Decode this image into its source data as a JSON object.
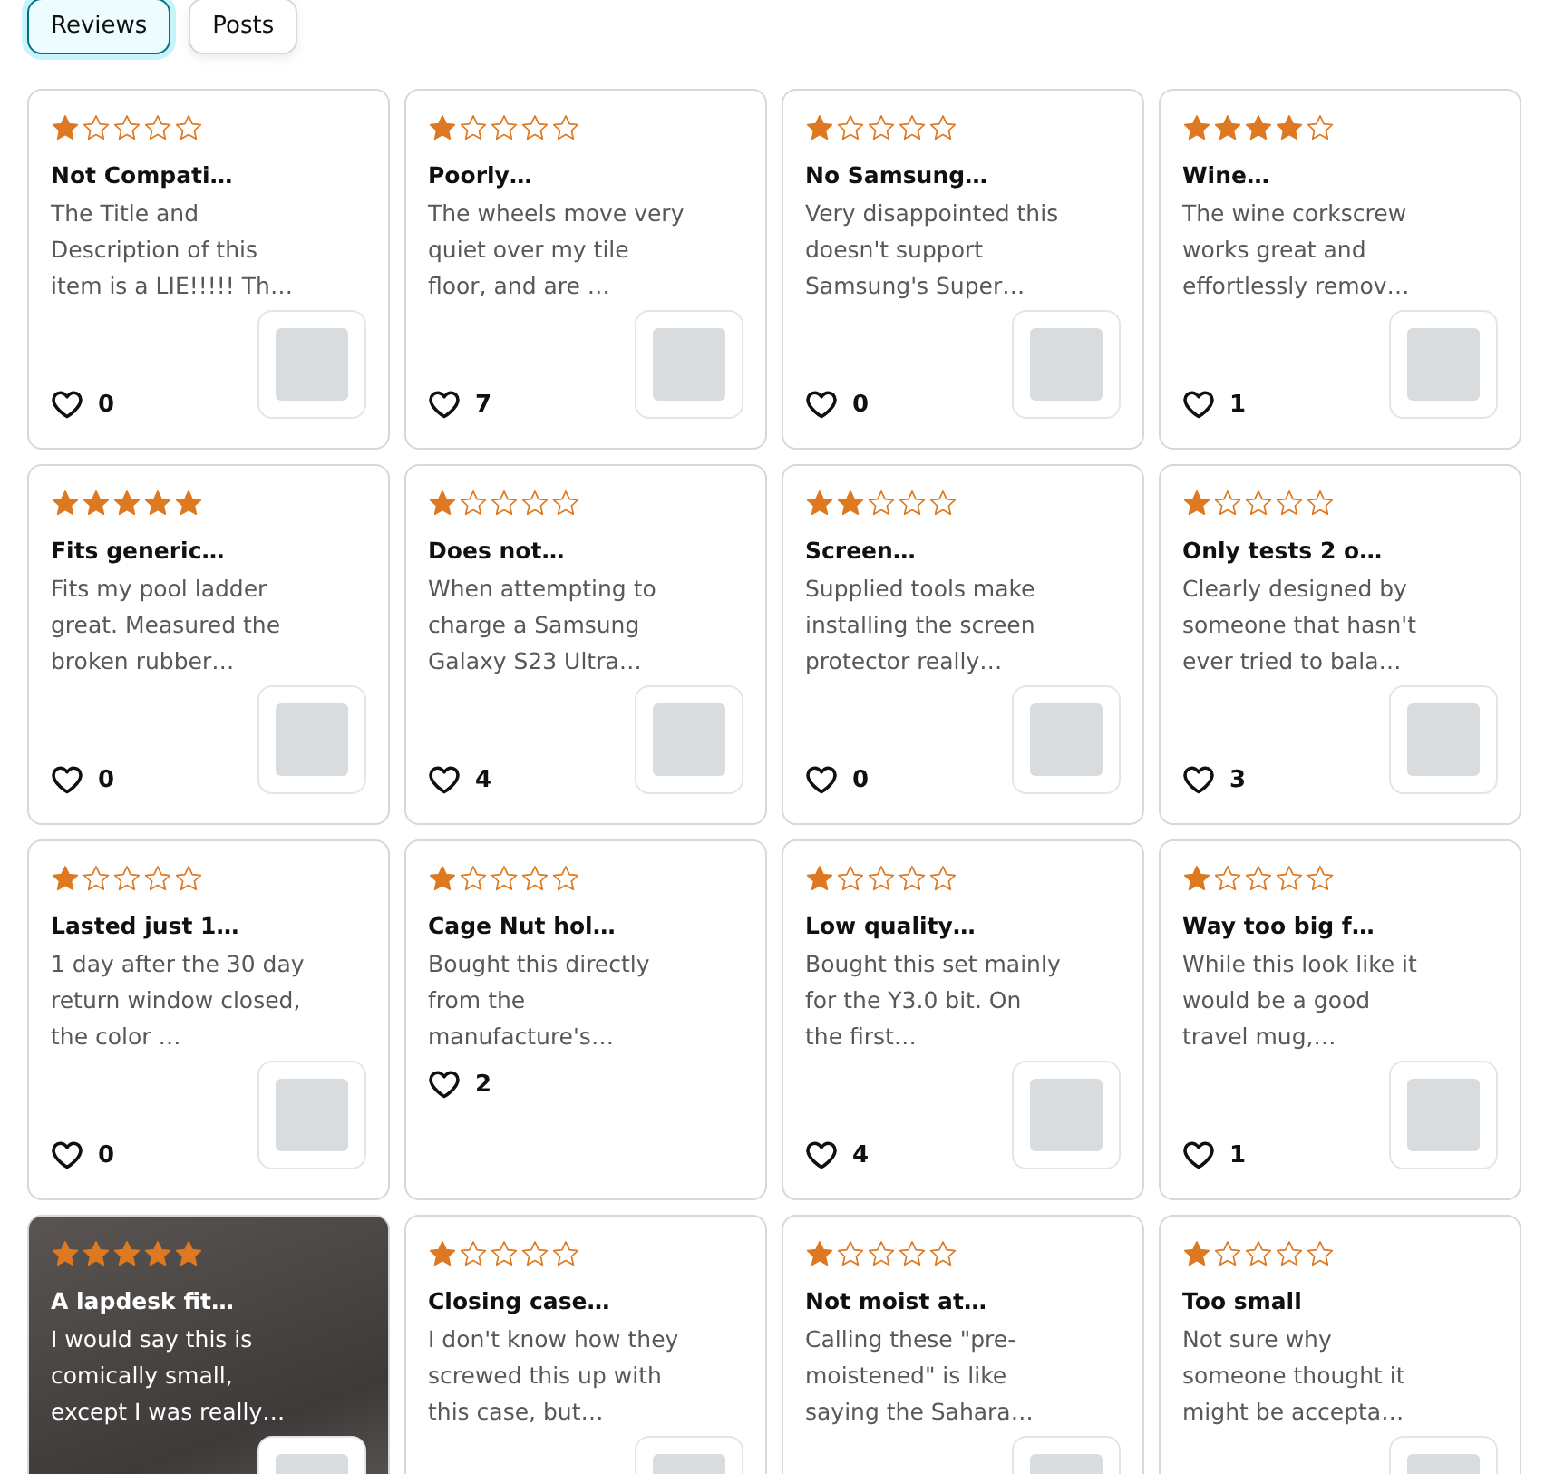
{
  "tabs": [
    {
      "label": "Reviews",
      "selected": true
    },
    {
      "label": "Posts",
      "selected": false
    }
  ],
  "cards": [
    {
      "kind": "text",
      "stars": 1,
      "title": "Not Compati…",
      "body": "The Title and Description of this item is a LIE!!!!! Th…",
      "likes": "0",
      "thumbnail": true
    },
    {
      "kind": "text",
      "stars": 1,
      "title": "Poorly…",
      "body": "The wheels move very quiet over my tile floor, and are …",
      "likes": "7",
      "thumbnail": true
    },
    {
      "kind": "text",
      "stars": 1,
      "title": "No Samsung…",
      "body": "Very disappointed this doesn't support Samsung's Super…",
      "likes": "0",
      "thumbnail": true
    },
    {
      "kind": "text",
      "stars": 4,
      "title": "Wine…",
      "body": "The wine corkscrew works great and effortlessly remov…",
      "likes": "1",
      "thumbnail": true
    },
    {
      "kind": "text",
      "stars": 5,
      "title": "Fits generic…",
      "body": "Fits my pool ladder great. Measured the broken rubber…",
      "likes": "0",
      "thumbnail": true
    },
    {
      "kind": "text",
      "stars": 1,
      "title": "Does not…",
      "body": "When attempting to charge a Samsung Galaxy S23 Ultra…",
      "likes": "4",
      "thumbnail": true
    },
    {
      "kind": "text",
      "stars": 2,
      "title": "Screen…",
      "body": "Supplied tools make installing the screen protector really…",
      "likes": "0",
      "thumbnail": true
    },
    {
      "kind": "text",
      "stars": 1,
      "title": "Only tests 2 o…",
      "body": "Clearly designed by someone that hasn't ever tried to bala…",
      "likes": "3",
      "thumbnail": true
    },
    {
      "kind": "text",
      "stars": 1,
      "title": "Lasted just 1…",
      "body": "1 day after the 30 day return window closed, the color …",
      "likes": "0",
      "thumbnail": true
    },
    {
      "kind": "text",
      "stars": 1,
      "title": "Cage Nut hol…",
      "body": "Bought this directly from the manufacture's…",
      "likes": "2",
      "thumbnail": false
    },
    {
      "kind": "text",
      "stars": 1,
      "title": "Low quality…",
      "body": "Bought this set mainly for the Y3.0 bit. On the first…",
      "likes": "4",
      "thumbnail": true
    },
    {
      "kind": "text",
      "stars": 1,
      "title": "Way too big f…",
      "body": "While this look like it would be a good travel mug,…",
      "likes": "1",
      "thumbnail": true
    },
    {
      "kind": "photo",
      "stars": 5,
      "title": "A lapdesk fit…",
      "body": "I would say this is comically small, except I was really…",
      "thumbnail": true
    },
    {
      "kind": "text",
      "stars": 1,
      "title": "Closing case…",
      "body": "I don't know how they screwed this up with this case, but…",
      "thumbnail": true
    },
    {
      "kind": "text",
      "stars": 1,
      "title": "Not moist at…",
      "body": "Calling these \"pre-moistened\" is like saying the Sahara…",
      "thumbnail": true
    },
    {
      "kind": "text",
      "stars": 1,
      "title": "Too small",
      "body": "Not sure why someone thought it might be accepta…",
      "thumbnail": true
    }
  ]
}
